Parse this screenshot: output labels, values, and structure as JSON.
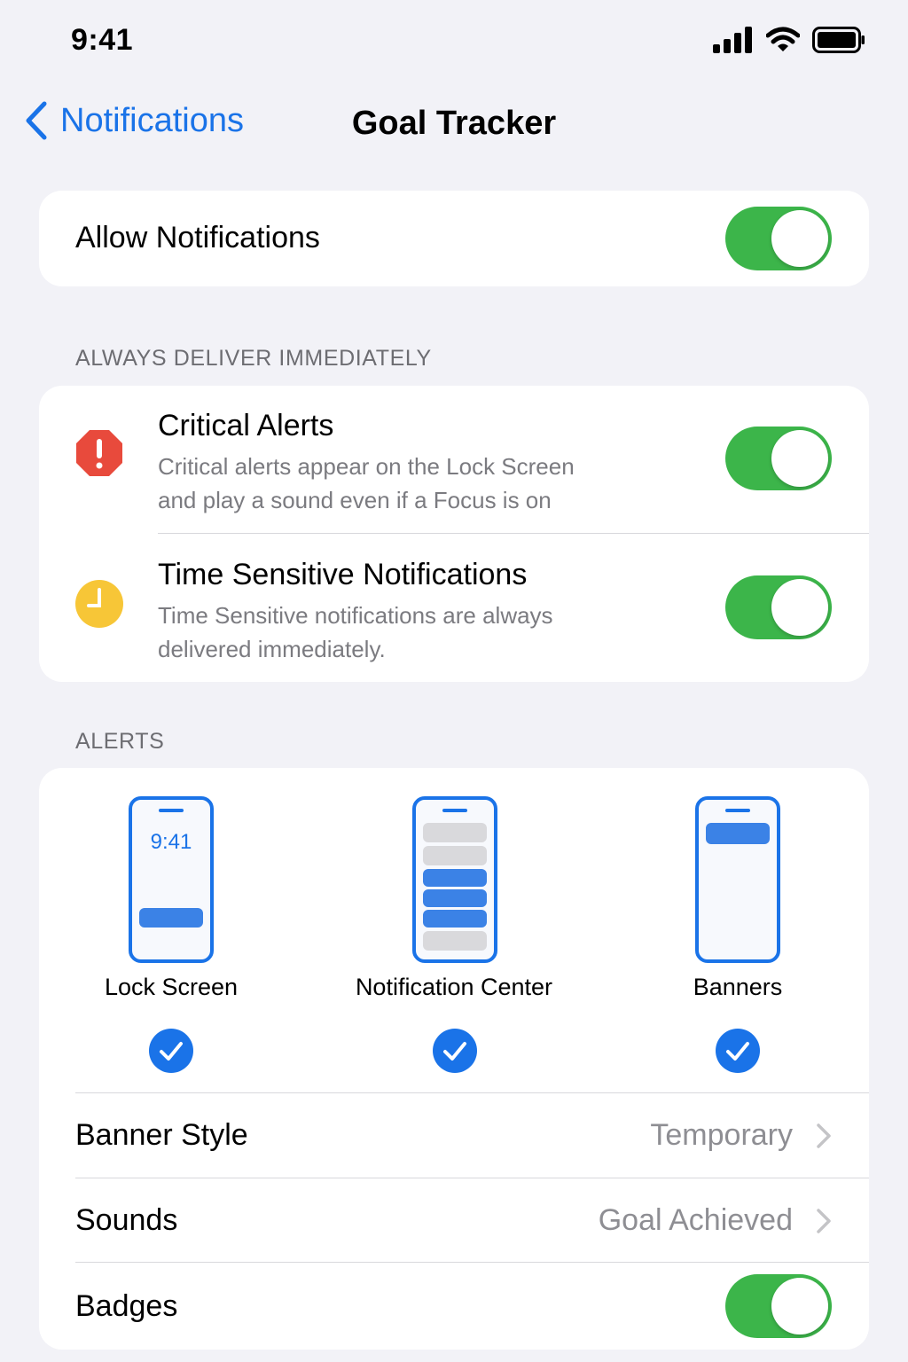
{
  "status_bar": {
    "time": "9:41",
    "icons": [
      "cellular-signal-icon",
      "wifi-icon",
      "battery-icon"
    ]
  },
  "nav": {
    "back_label": "Notifications",
    "title": "Goal Tracker"
  },
  "allow_notifications": {
    "label": "Allow Notifications",
    "enabled": true
  },
  "section_immediate": {
    "header": "ALWAYS DELIVER IMMEDIATELY",
    "items": [
      {
        "title": "Critical Alerts",
        "desc_line1": "Critical alerts appear on the Lock Screen",
        "desc_line2": "and play a sound even if a Focus is on",
        "icon": "critical-alert-icon",
        "enabled": true
      },
      {
        "title": "Time Sensitive Notifications",
        "desc_line1": "Time Sensitive notifications are always",
        "desc_line2": "delivered immediately.",
        "icon": "clock-icon",
        "enabled": true
      }
    ]
  },
  "section_alerts": {
    "header": "ALERTS",
    "styles": [
      {
        "label": "Lock Screen",
        "preview_time": "9:41",
        "checked": true
      },
      {
        "label": "Notification Center",
        "checked": true
      },
      {
        "label": "Banners",
        "checked": true
      }
    ],
    "banner_style": {
      "label": "Banner Style",
      "value": "Temporary"
    },
    "sounds": {
      "label": "Sounds",
      "value": "Goal Achieved"
    },
    "badges": {
      "label": "Badges",
      "enabled": true
    }
  },
  "colors": {
    "accent": "#1a73e8",
    "toggle_on": "#3cb54a",
    "critical": "#e84a3c",
    "time_sensitive": "#f7c637"
  }
}
